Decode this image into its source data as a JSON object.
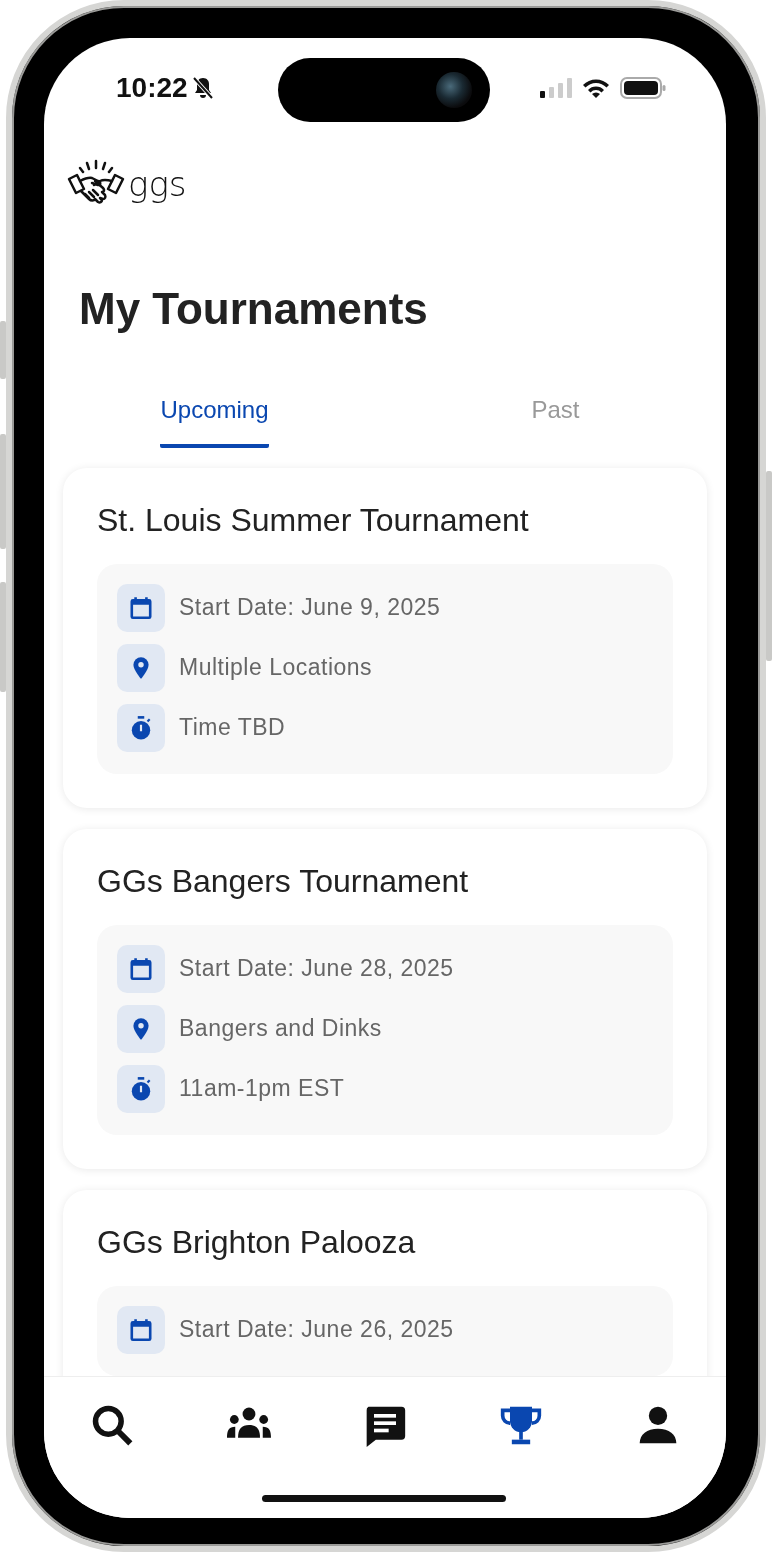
{
  "status_bar": {
    "time": "10:22",
    "silenced": true
  },
  "app": {
    "logo_text": "ggs"
  },
  "title": "My Tournaments",
  "tabs": [
    {
      "label": "Upcoming",
      "selected": true
    },
    {
      "label": "Past",
      "selected": false
    }
  ],
  "tournaments": [
    {
      "name": "St. Louis Summer Tournament",
      "details": [
        {
          "kind": "date",
          "text": "Start Date: June 9, 2025"
        },
        {
          "kind": "location",
          "text": "Multiple Locations"
        },
        {
          "kind": "time",
          "text": "Time TBD"
        }
      ]
    },
    {
      "name": "GGs Bangers Tournament",
      "details": [
        {
          "kind": "date",
          "text": "Start Date: June 28, 2025"
        },
        {
          "kind": "location",
          "text": "Bangers and Dinks"
        },
        {
          "kind": "time",
          "text": "11am-1pm EST"
        }
      ]
    },
    {
      "name": "GGs Brighton Palooza",
      "details": [
        {
          "kind": "date",
          "text": "Start Date: June 26, 2025"
        }
      ]
    }
  ],
  "nav": [
    {
      "kind": "search",
      "selected": false
    },
    {
      "kind": "groups",
      "selected": false
    },
    {
      "kind": "messages",
      "selected": false
    },
    {
      "kind": "trophy",
      "selected": true
    },
    {
      "kind": "profile",
      "selected": false
    }
  ]
}
